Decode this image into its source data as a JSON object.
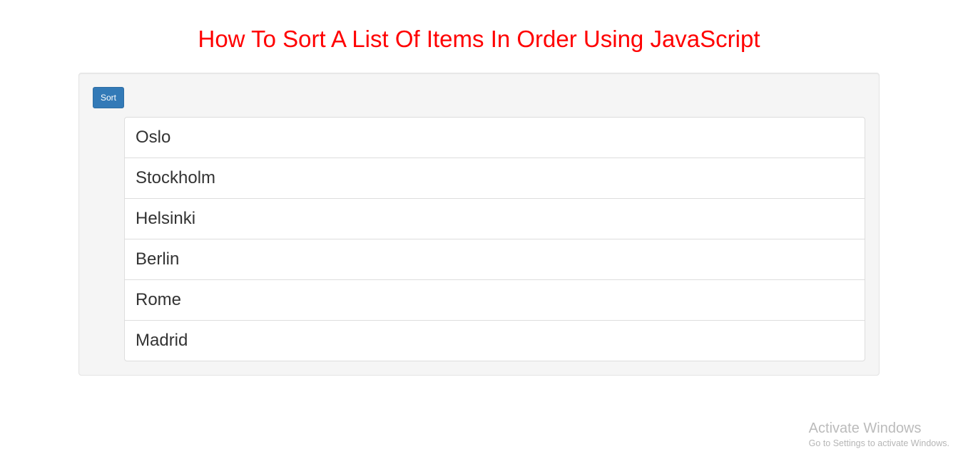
{
  "title": "How To Sort A List Of Items In Order Using JavaScript",
  "sortButton": {
    "label": "Sort"
  },
  "items": [
    "Oslo",
    "Stockholm",
    "Helsinki",
    "Berlin",
    "Rome",
    "Madrid"
  ],
  "watermark": {
    "title": "Activate Windows",
    "subtitle": "Go to Settings to activate Windows."
  }
}
